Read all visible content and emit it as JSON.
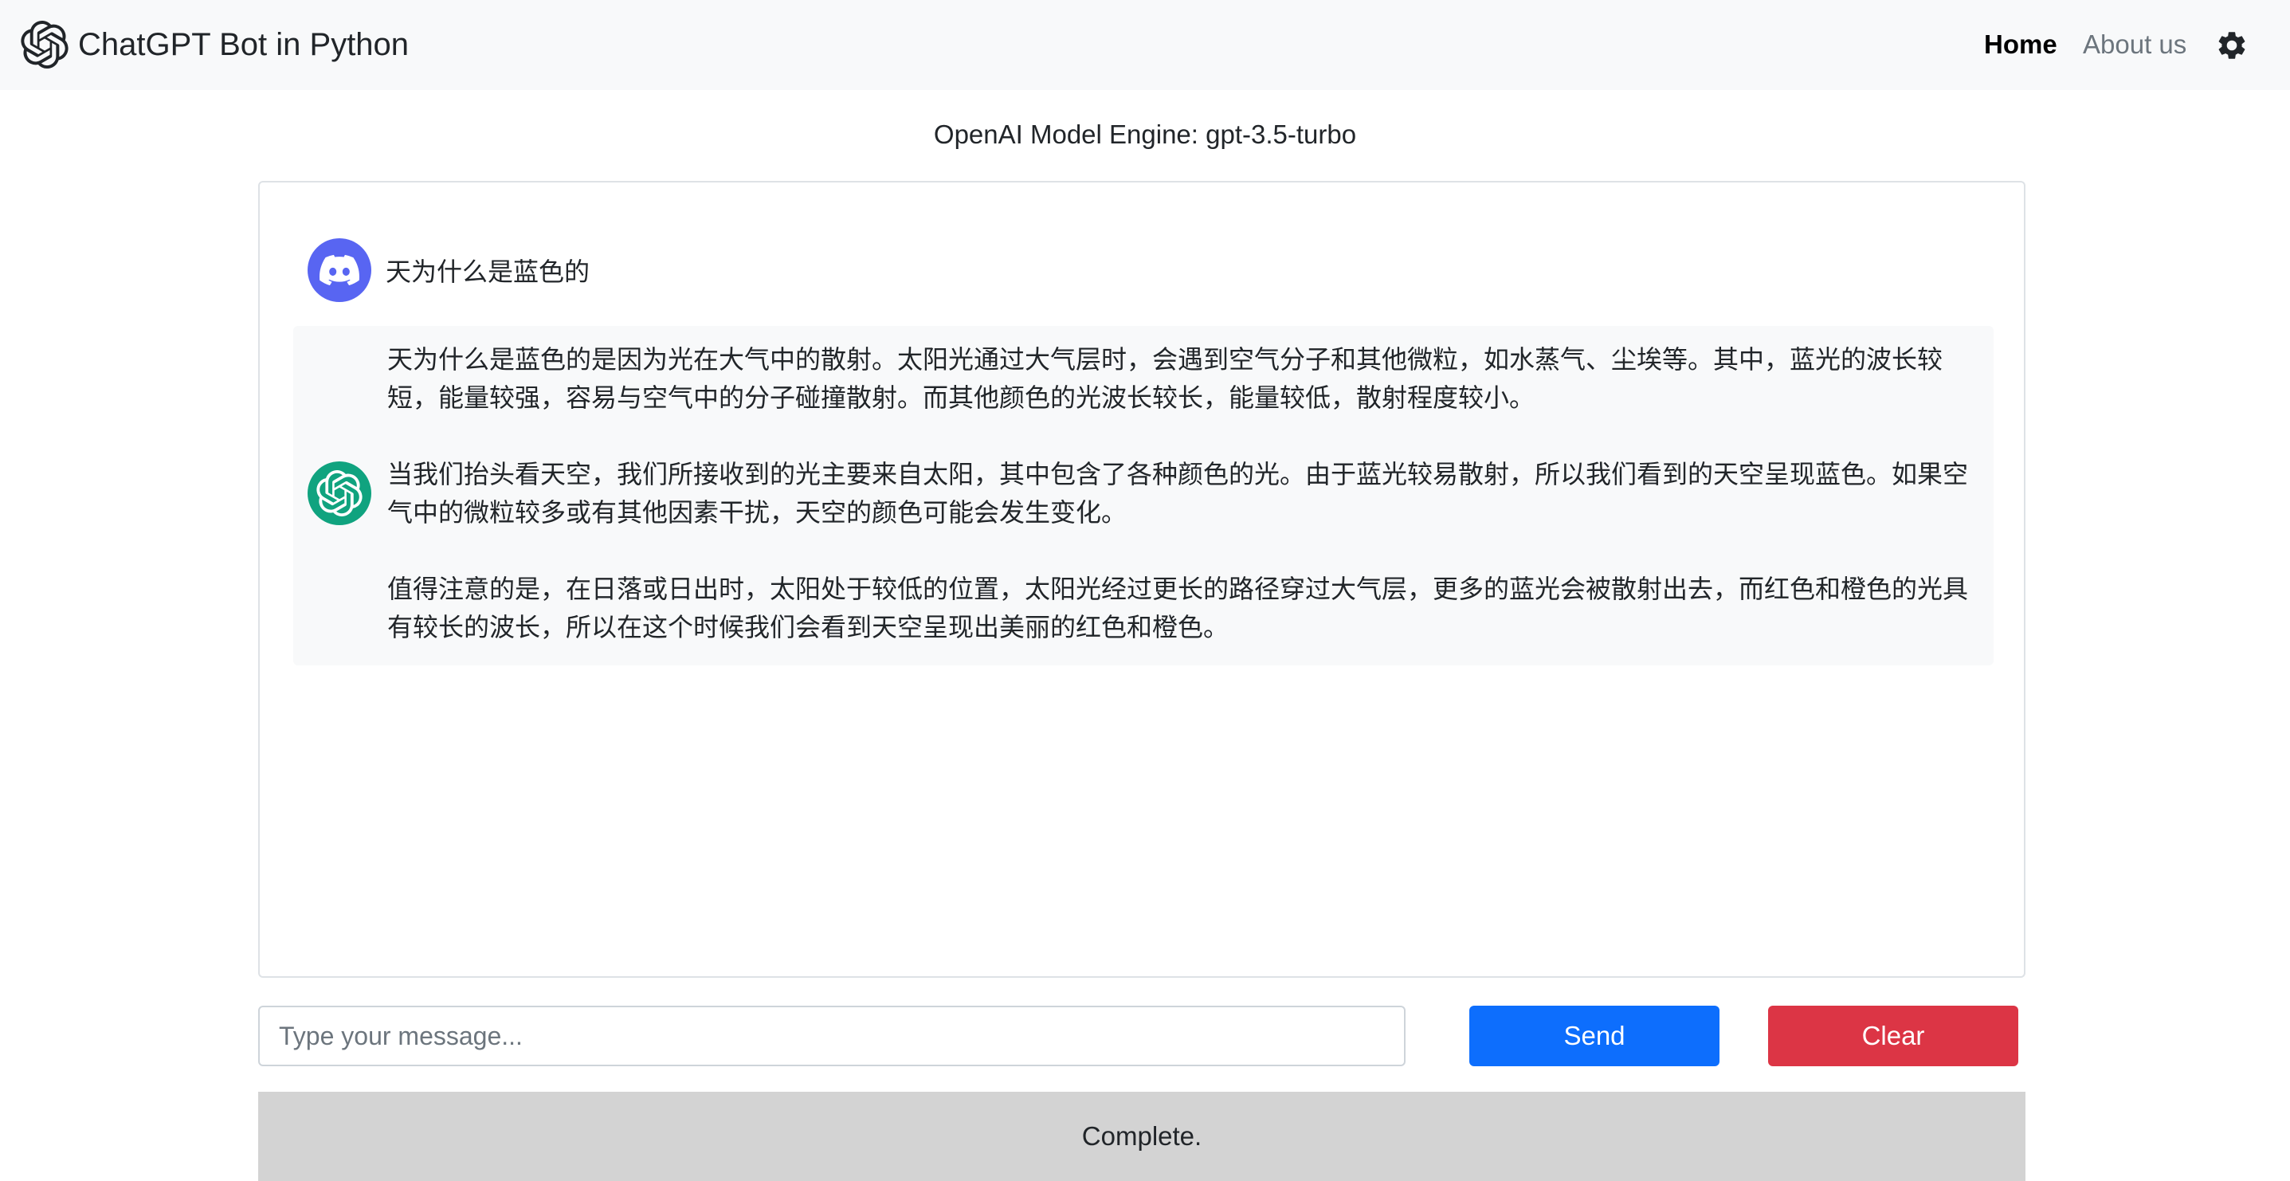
{
  "navbar": {
    "brand": "ChatGPT Bot in Python",
    "links": [
      {
        "label": "Home",
        "active": true
      },
      {
        "label": "About us",
        "active": false
      }
    ],
    "settings_icon": "gear-icon"
  },
  "engine_label": "OpenAI Model Engine: gpt-3.5-turbo",
  "conversation": {
    "user_message": {
      "avatar": "discord-icon",
      "text": "天为什么是蓝色的"
    },
    "bot_message": {
      "avatar": "openai-icon",
      "paragraphs": [
        "天为什么是蓝色的是因为光在大气中的散射。太阳光通过大气层时，会遇到空气分子和其他微粒，如水蒸气、尘埃等。其中，蓝光的波长较短，能量较强，容易与空气中的分子碰撞散射。而其他颜色的光波长较长，能量较低，散射程度较小。",
        "当我们抬头看天空，我们所接收到的光主要来自太阳，其中包含了各种颜色的光。由于蓝光较易散射，所以我们看到的天空呈现蓝色。如果空气中的微粒较多或有其他因素干扰，天空的颜色可能会发生变化。",
        "值得注意的是，在日落或日出时，太阳处于较低的位置，太阳光经过更长的路径穿过大气层，更多的蓝光会被散射出去，而红色和橙色的光具有较长的波长，所以在这个时候我们会看到天空呈现出美丽的红色和橙色。"
      ]
    }
  },
  "input": {
    "placeholder": "Type your message...",
    "value": ""
  },
  "buttons": {
    "send": "Send",
    "clear": "Clear"
  },
  "status": "Complete.",
  "colors": {
    "navbar_bg": "#f8f9fa",
    "send_button": "#0d6efd",
    "clear_button": "#dc3545",
    "discord_avatar": "#5865f2",
    "openai_avatar": "#10a37f",
    "status_bg": "#d3d3d3"
  }
}
